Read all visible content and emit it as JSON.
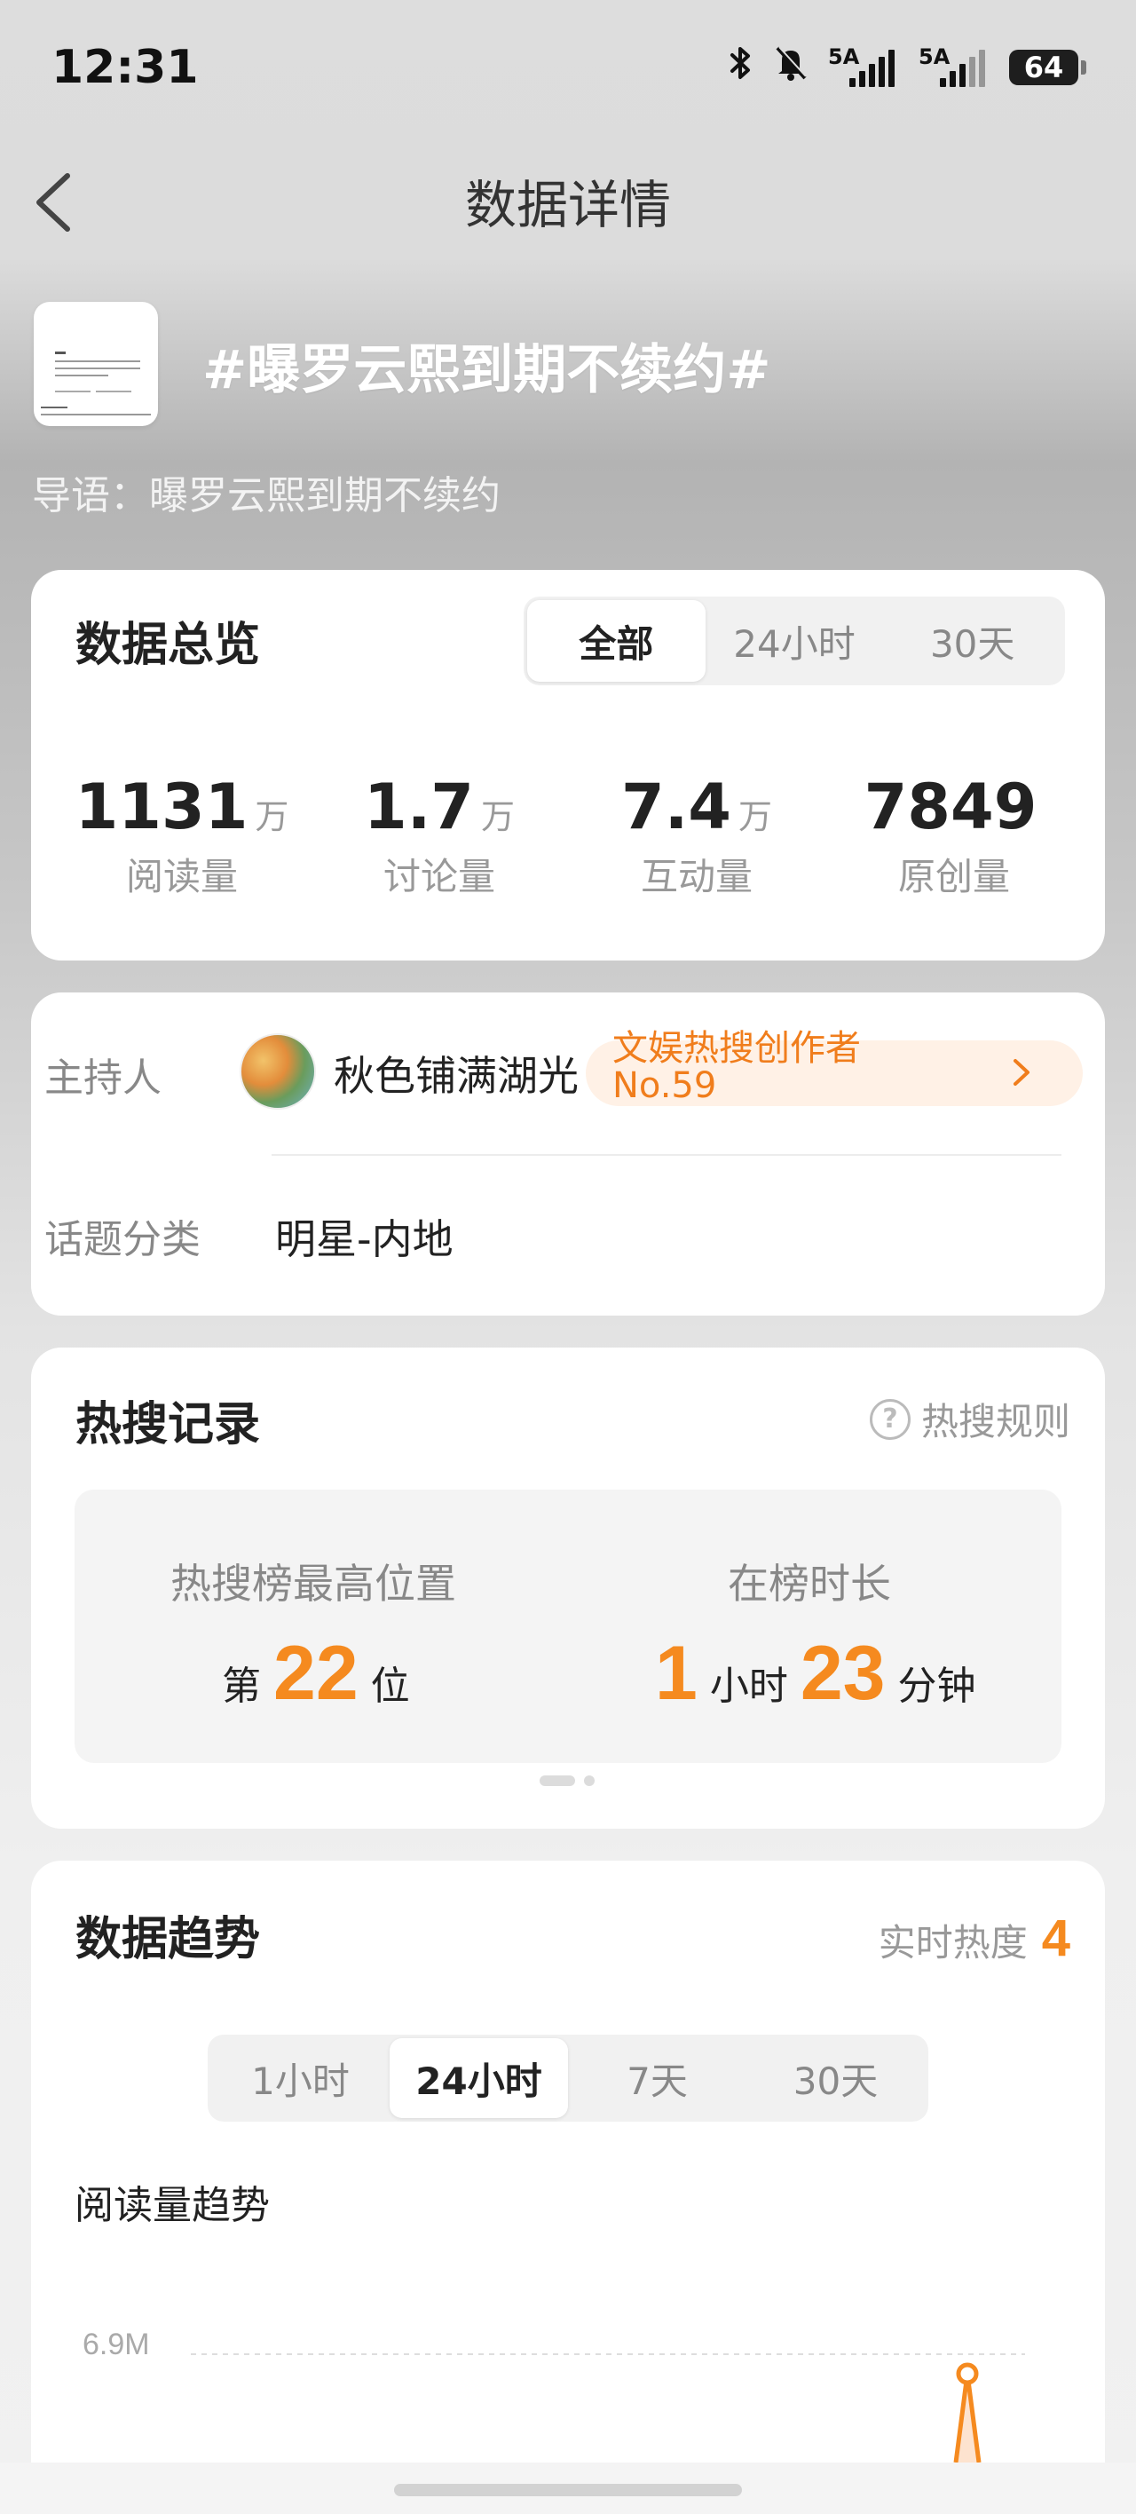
{
  "status_bar": {
    "time": "12:31",
    "network_1": "5A",
    "network_2": "5A",
    "battery": "64"
  },
  "header": {
    "title": "数据详情"
  },
  "topic": {
    "title": "#曝罗云熙到期不续约#",
    "guide": "导语：曝罗云熙到期不续约"
  },
  "overview": {
    "title": "数据总览",
    "tabs": [
      {
        "label": "全部",
        "active": true
      },
      {
        "label": "24小时",
        "active": false
      },
      {
        "label": "30天",
        "active": false
      }
    ],
    "stats": [
      {
        "value": "1131",
        "unit": "万",
        "label": "阅读量"
      },
      {
        "value": "1.7",
        "unit": "万",
        "label": "讨论量"
      },
      {
        "value": "7.4",
        "unit": "万",
        "label": "互动量"
      },
      {
        "value": "7849",
        "unit": "",
        "label": "原创量"
      }
    ]
  },
  "info": {
    "host_label": "主持人",
    "host_name": "秋色铺满湖光",
    "host_rank_line1": "文娱热搜创作者",
    "host_rank_line2": "No.59",
    "category_label": "话题分类",
    "category_value": "明星-内地"
  },
  "hot_search": {
    "title": "热搜记录",
    "rules_link": "热搜规则",
    "peak_label": "热搜榜最高位置",
    "peak_prefix": "第",
    "peak_value": "22",
    "peak_suffix": "位",
    "duration_label": "在榜时长",
    "duration_hours": "1",
    "duration_hours_unit": "小时",
    "duration_minutes": "23",
    "duration_minutes_unit": "分钟"
  },
  "trend": {
    "title": "数据趋势",
    "realtime_label": "实时热度",
    "realtime_value": "4",
    "tabs": [
      {
        "label": "1小时",
        "active": false
      },
      {
        "label": "24小时",
        "active": true
      },
      {
        "label": "7天",
        "active": false
      },
      {
        "label": "30天",
        "active": false
      }
    ],
    "chart_title": "阅读量趋势",
    "y_tick": "6.9M"
  },
  "colors": {
    "accent": "#f58a1f",
    "accent_light": "#fff1e6"
  },
  "chart_data": {
    "type": "line",
    "title": "阅读量趋势",
    "y_ticks": [
      "6.9M"
    ],
    "series": [
      {
        "values": [
          0,
          6900000
        ]
      }
    ]
  }
}
